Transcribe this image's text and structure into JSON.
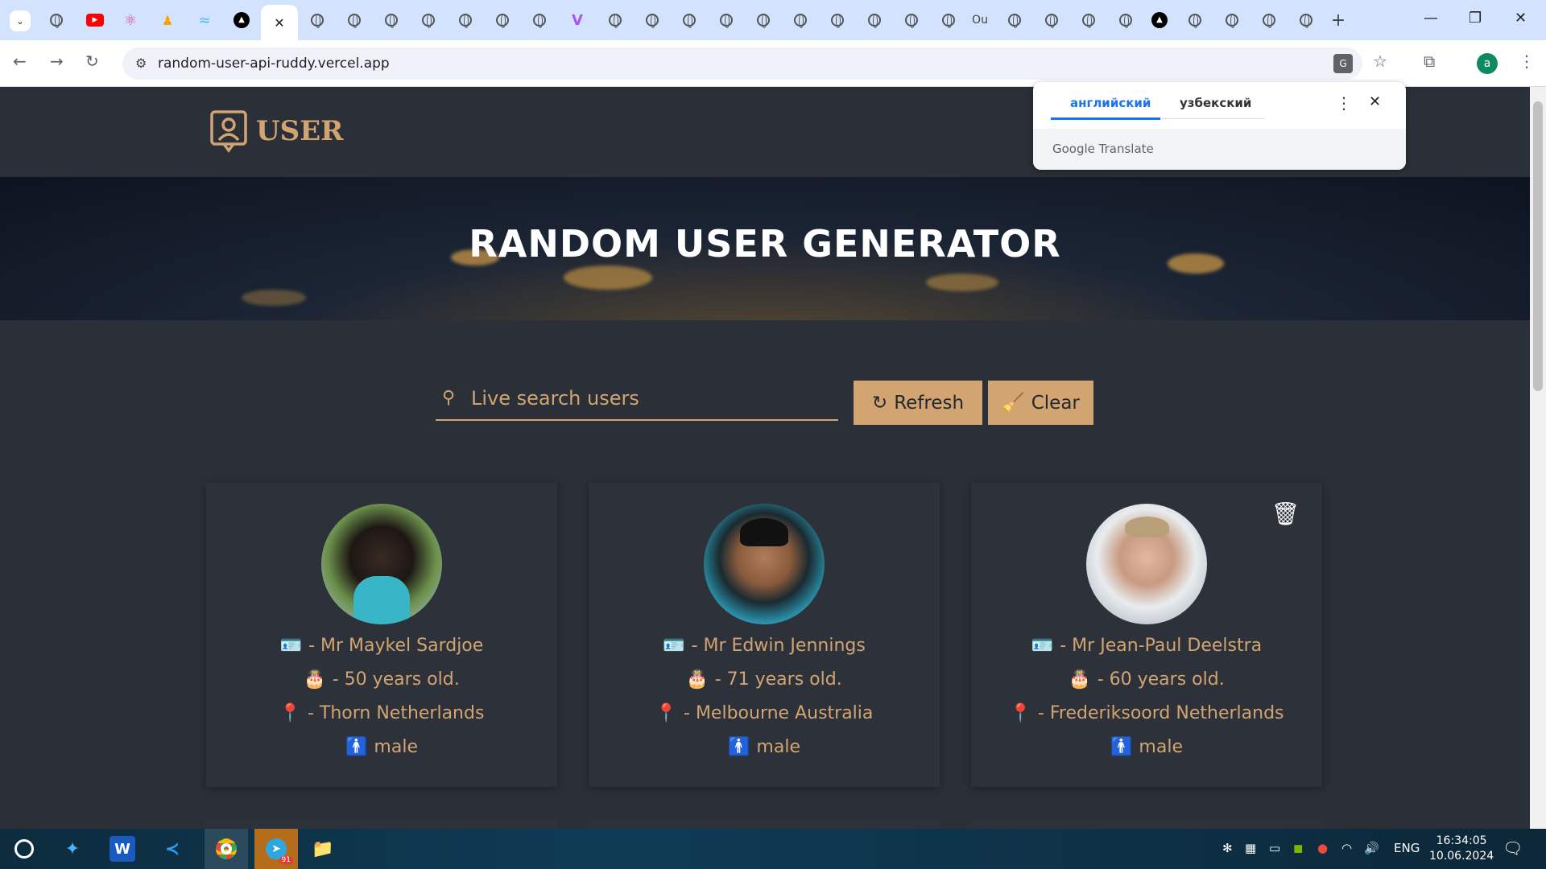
{
  "browser": {
    "url": "random-user-api-ruddy.vercel.app",
    "tab_count_label": "Ou"
  },
  "translate_popup": {
    "source_lang": "английский",
    "target_lang": "узбекский",
    "brand": "Google Translate"
  },
  "site": {
    "logo_text": "USER",
    "banner_title": "RANDOM USER GENERATOR",
    "search": {
      "placeholder": "Live search users",
      "value": ""
    },
    "refresh_label": "Refresh",
    "clear_label": "Clear"
  },
  "users": [
    {
      "name": "- Mr Maykel  Sardjoe",
      "age": "-  50 years old.",
      "location": "- Thorn Netherlands",
      "gender": "male"
    },
    {
      "name": "- Mr Edwin  Jennings",
      "age": "-  71 years old.",
      "location": "- Melbourne Australia",
      "gender": "male"
    },
    {
      "name": "- Mr Jean-Paul  Deelstra",
      "age": "-  60 years old.",
      "location": "- Frederiksoord Netherlands",
      "gender": "male"
    }
  ],
  "taskbar": {
    "lang": "ENG",
    "time": "16:34:05",
    "date": "10.06.2024",
    "telegram_badge": "91"
  },
  "colors": {
    "accent": "#d2a472",
    "page_bg": "#2b3038",
    "card_bg": "#2d323a"
  }
}
